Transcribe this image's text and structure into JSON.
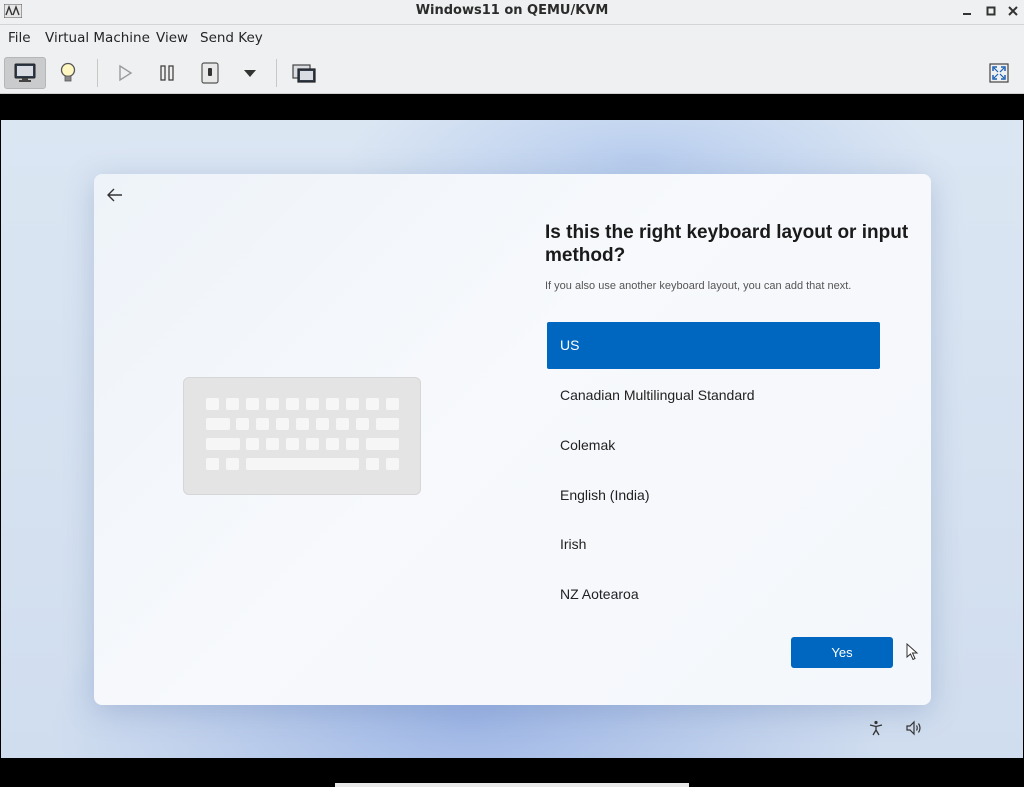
{
  "window": {
    "title": "Windows11 on QEMU/KVM",
    "controls": [
      "minimize-icon",
      "maximize-icon",
      "close-icon"
    ]
  },
  "menubar": {
    "items": [
      {
        "label": "File"
      },
      {
        "label": "Virtual Machine"
      },
      {
        "label": "View"
      },
      {
        "label": "Send Key"
      }
    ]
  },
  "toolbar": {
    "items": [
      "monitor-icon",
      "lightbulb-icon",
      "play-icon",
      "pause-icon",
      "power-icon",
      "dropdown-arrow-icon",
      "screenshot-icon",
      "fullscreen-icon"
    ]
  },
  "setup": {
    "heading": "Is this the right keyboard layout or input method?",
    "subtext": "If you also use another keyboard layout, you can add that next.",
    "options": [
      {
        "label": "US",
        "selected": true
      },
      {
        "label": "Canadian Multilingual Standard",
        "selected": false
      },
      {
        "label": "Colemak",
        "selected": false
      },
      {
        "label": "English (India)",
        "selected": false
      },
      {
        "label": "Irish",
        "selected": false
      },
      {
        "label": "NZ Aotearoa",
        "selected": false
      }
    ],
    "yes_label": "Yes"
  },
  "colors": {
    "accent": "#0067c0",
    "chrome": "#eff0f1"
  }
}
